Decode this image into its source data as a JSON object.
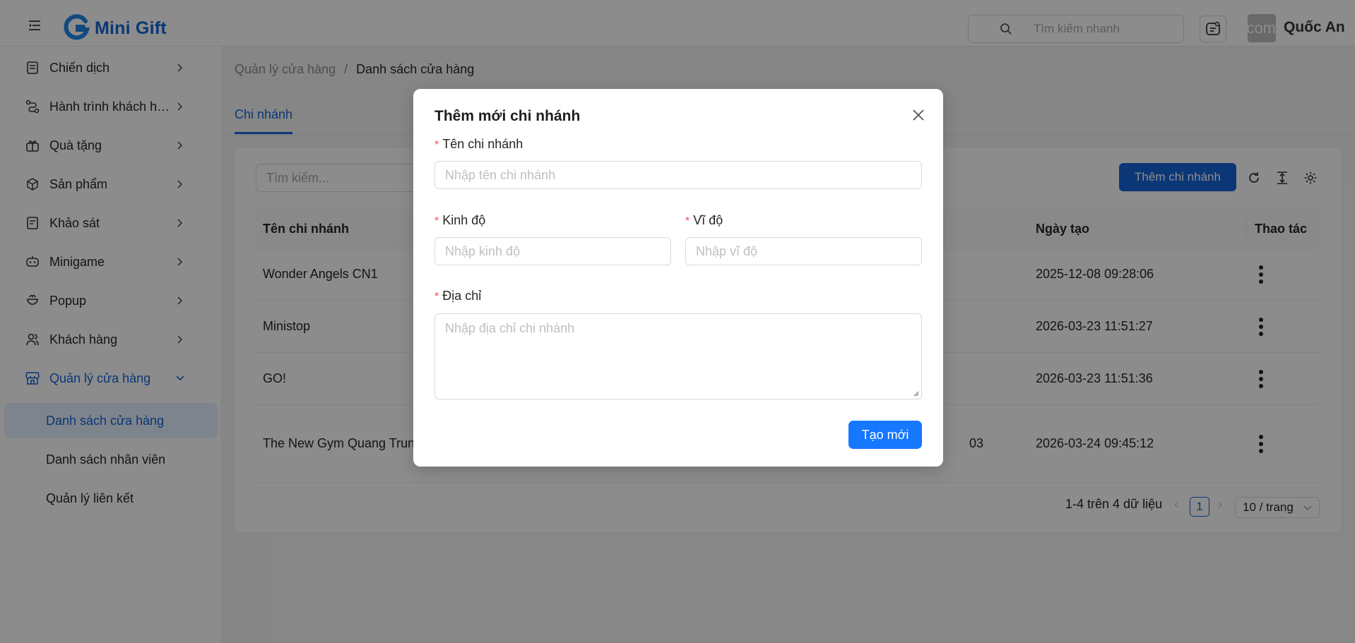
{
  "app": {
    "name": "Mini Gift"
  },
  "header": {
    "search_placeholder": "Tìm kiếm nhanh",
    "avatar_text": "com",
    "user_name": "Quốc An"
  },
  "sidebar": {
    "items": [
      {
        "label": "Chiến dịch",
        "icon": "campaign-icon"
      },
      {
        "label": "Hành trình khách hàng",
        "icon": "journey-icon"
      },
      {
        "label": "Quà tặng",
        "icon": "gift-icon"
      },
      {
        "label": "Sản phẩm",
        "icon": "box-icon"
      },
      {
        "label": "Khảo sát",
        "icon": "survey-icon"
      },
      {
        "label": "Minigame",
        "icon": "gamepad-icon"
      },
      {
        "label": "Popup",
        "icon": "popup-icon"
      },
      {
        "label": "Khách hàng",
        "icon": "users-icon"
      },
      {
        "label": "Quản lý cửa hàng",
        "icon": "store-icon",
        "active": true
      }
    ],
    "sub_items": [
      {
        "label": "Danh sách cửa hàng",
        "selected": true
      },
      {
        "label": "Danh sách nhân viên"
      },
      {
        "label": "Quản lý liên kết"
      }
    ]
  },
  "breadcrumb": {
    "parent": "Quản lý cửa hàng",
    "separator": "/",
    "current": "Danh sách cửa hàng"
  },
  "tabs": [
    {
      "label": "Chi nhánh",
      "active": true
    }
  ],
  "toolbar": {
    "search_placeholder": "Tìm kiếm...",
    "add_label": "Thêm chi nhánh"
  },
  "table": {
    "columns": {
      "name": "Tên chi nhánh",
      "created": "Ngày tạo",
      "actions": "Thao tác"
    },
    "rows": [
      {
        "name": "Wonder Angels CN1",
        "extra": "",
        "created": "2025-12-08 09:28:06"
      },
      {
        "name": "Ministop",
        "extra": "",
        "created": "2026-03-23 11:51:27"
      },
      {
        "name": "GO!",
        "extra": "",
        "created": "2026-03-23 11:51:36"
      },
      {
        "name": "The New Gym Quang Trung",
        "extra": "03",
        "created": "2026-03-24 09:45:12"
      }
    ]
  },
  "pagination": {
    "summary": "1-4 trên 4 dữ liệu",
    "current_page": "1",
    "page_size": "10 / trang"
  },
  "modal": {
    "title": "Thêm mới chi nhánh",
    "required_mark": "*",
    "fields": {
      "name": {
        "label": "Tên chi nhánh",
        "placeholder": "Nhập tên chi nhánh",
        "value": ""
      },
      "longitude": {
        "label": "Kinh độ",
        "placeholder": "Nhập kinh độ",
        "value": ""
      },
      "latitude": {
        "label": "Vĩ độ",
        "placeholder": "Nhập vĩ độ",
        "value": ""
      },
      "address": {
        "label": "Địa chỉ",
        "placeholder": "Nhập địa chỉ chi nhánh",
        "value": ""
      }
    },
    "submit_label": "Tạo mới"
  },
  "colors": {
    "primary": "#1565d8",
    "button": "#1677ff",
    "required": "#ff4d4f",
    "overlay": "rgba(0,0,0,0.45)"
  }
}
